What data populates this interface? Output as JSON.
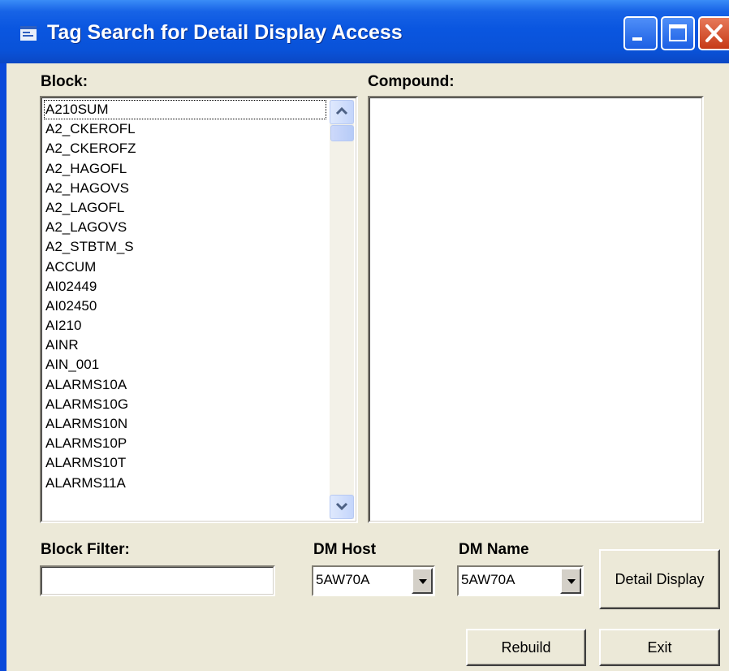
{
  "window": {
    "title": "Tag Search for Detail Display Access",
    "accent": "#0a56e0",
    "controls": [
      "minimize-icon",
      "maximize-icon",
      "close-icon"
    ]
  },
  "block": {
    "label": "Block:",
    "items": [
      "A210SUM",
      "A2_CKEROFL",
      "A2_CKEROFZ",
      "A2_HAGOFL",
      "A2_HAGOVS",
      "A2_LAGOFL",
      "A2_LAGOVS",
      "A2_STBTM_S",
      "ACCUM",
      "AI02449",
      "AI02450",
      "AI210",
      "AINR",
      "AIN_001",
      "ALARMS10A",
      "ALARMS10G",
      "ALARMS10N",
      "ALARMS10P",
      "ALARMS10T",
      "ALARMS11A"
    ],
    "focused_item": "A210SUM"
  },
  "compound": {
    "label": "Compound:",
    "items": []
  },
  "block_filter": {
    "label": "Block Filter:",
    "value": ""
  },
  "dm_host": {
    "label": "DM Host",
    "value": "5AW70A"
  },
  "dm_name": {
    "label": "DM Name",
    "value": "5AW70A"
  },
  "buttons": {
    "detail_display": "Detail Display",
    "rebuild": "Rebuild",
    "exit": "Exit"
  }
}
